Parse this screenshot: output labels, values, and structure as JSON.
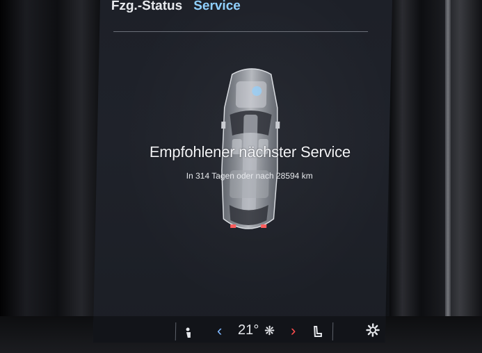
{
  "tabs": [
    {
      "label": "Fzg.-Status",
      "active": false
    },
    {
      "label": "Service",
      "active": true
    }
  ],
  "service": {
    "title": "Empfohlener nächster Service",
    "detail": "In 314 Tagen oder nach 28594 km"
  },
  "climate_bar": {
    "temperature": "21°",
    "fan_glyph": "❋",
    "left_arrow": "‹",
    "right_arrow": "›",
    "icons": [
      "seat-heat-icon",
      "fan-icon",
      "seat-icon",
      "settings-icon"
    ]
  },
  "colors": {
    "active_tab": "#8fd0ff",
    "arrow_left": "#7fb8ff",
    "arrow_right": "#ff4d4d"
  }
}
